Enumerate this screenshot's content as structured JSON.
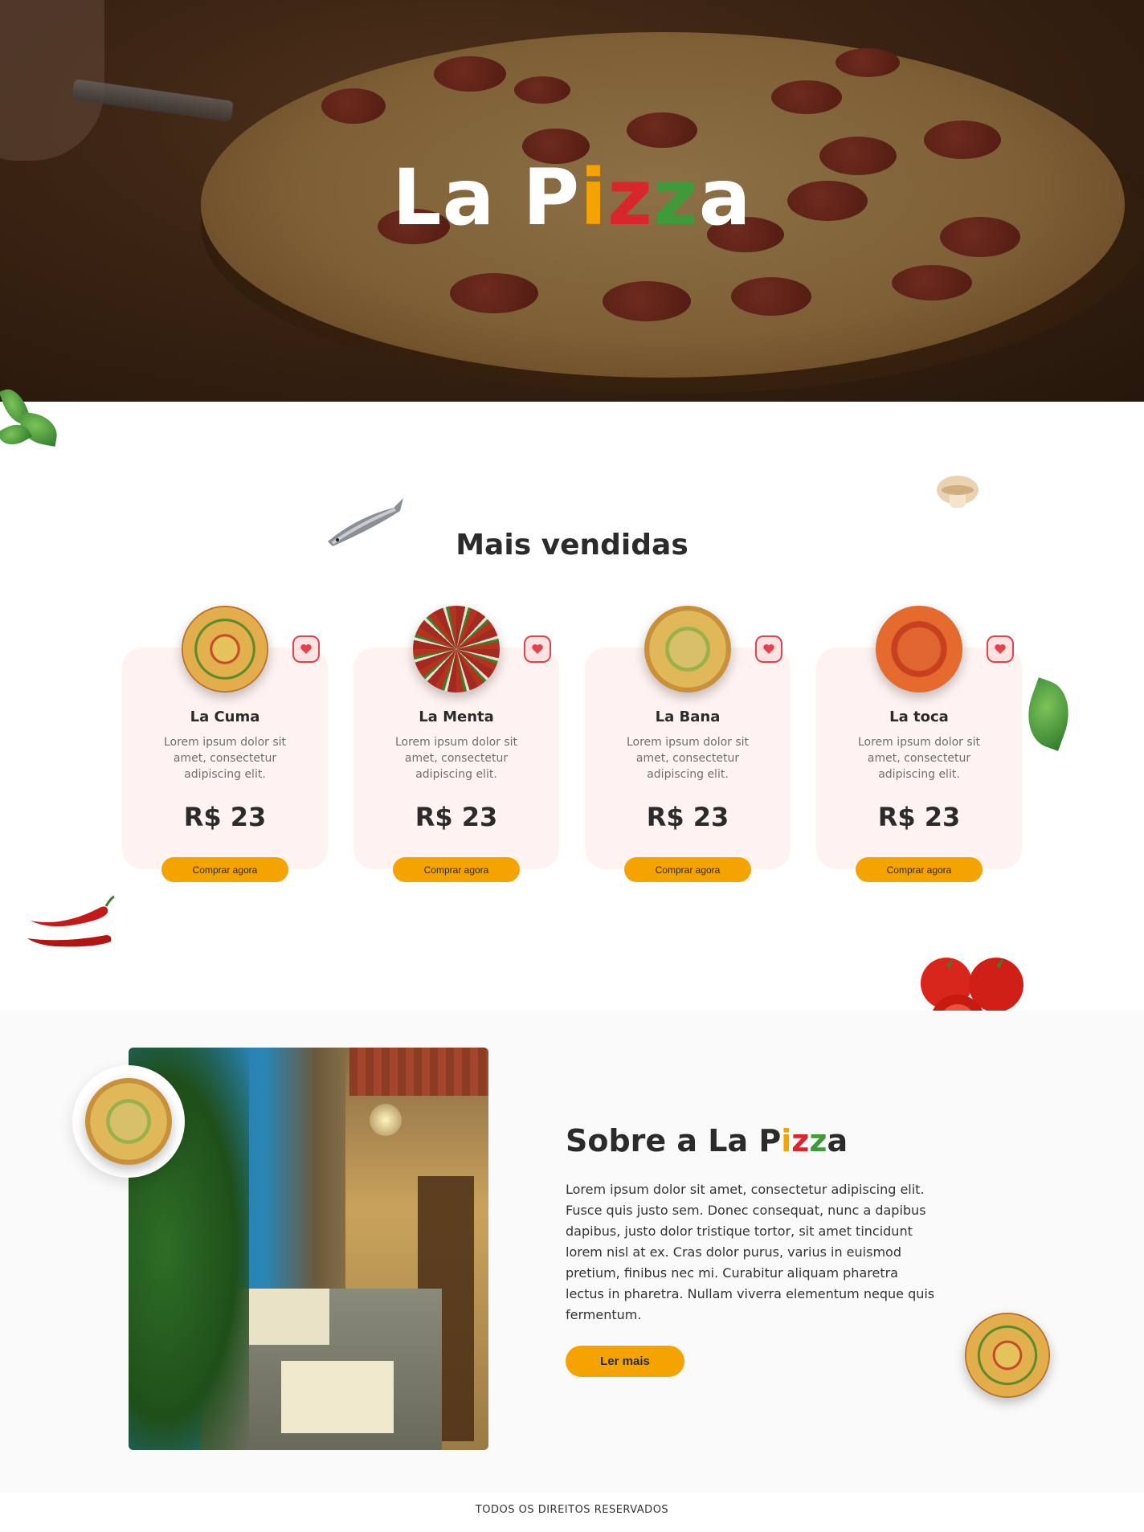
{
  "hero": {
    "title_parts": {
      "a": "La P",
      "b": "i",
      "c": "z",
      "d": "z",
      "e": "a"
    }
  },
  "best_sellers": {
    "title": "Mais vendidas",
    "items": [
      {
        "name": "La Cuma",
        "description": "Lorem ipsum dolor sit amet, consectetur adipiscing elit.",
        "price": "R$ 23",
        "button": "Comprar agora",
        "pizza_style": "veggie"
      },
      {
        "name": "La Menta",
        "description": "Lorem ipsum dolor sit amet, consectetur adipiscing elit.",
        "price": "R$ 23",
        "button": "Comprar agora",
        "pizza_style": "mint"
      },
      {
        "name": "La Bana",
        "description": "Lorem ipsum dolor sit amet, consectetur adipiscing elit.",
        "price": "R$ 23",
        "button": "Comprar agora",
        "pizza_style": "banana"
      },
      {
        "name": "La toca",
        "description": "Lorem ipsum dolor sit amet, consectetur adipiscing elit.",
        "price": "R$ 23",
        "button": "Comprar agora",
        "pizza_style": "pepperoni"
      }
    ]
  },
  "about": {
    "title_parts": {
      "a": "Sobre a La P",
      "b": "i",
      "c": "z",
      "d": "z",
      "e": "a"
    },
    "text": "Lorem ipsum dolor sit amet, consectetur adipiscing elit. Fusce quis justo sem. Donec consequat, nunc a dapibus dapibus, justo dolor tristique tortor, sit amet tincidunt lorem nisl at ex. Cras dolor purus, varius in euismod pretium, finibus nec mi. Curabitur aliquam pharetra lectus in pharetra. Nullam viverra elementum neque quis fermentum.",
    "button": "Ler mais"
  },
  "footer": {
    "text": "TODOS OS DIREITOS RESERVADOS"
  },
  "colors": {
    "accent": "#f5a300",
    "red": "#d9262a",
    "green": "#3f9a3a",
    "card_bg": "#fff3f1",
    "heart": "#e3424f"
  },
  "icons": [
    "heart-icon",
    "basil-leaf-icon",
    "sardine-icon",
    "mushroom-icon",
    "chili-pepper-icon",
    "tomato-icon"
  ]
}
